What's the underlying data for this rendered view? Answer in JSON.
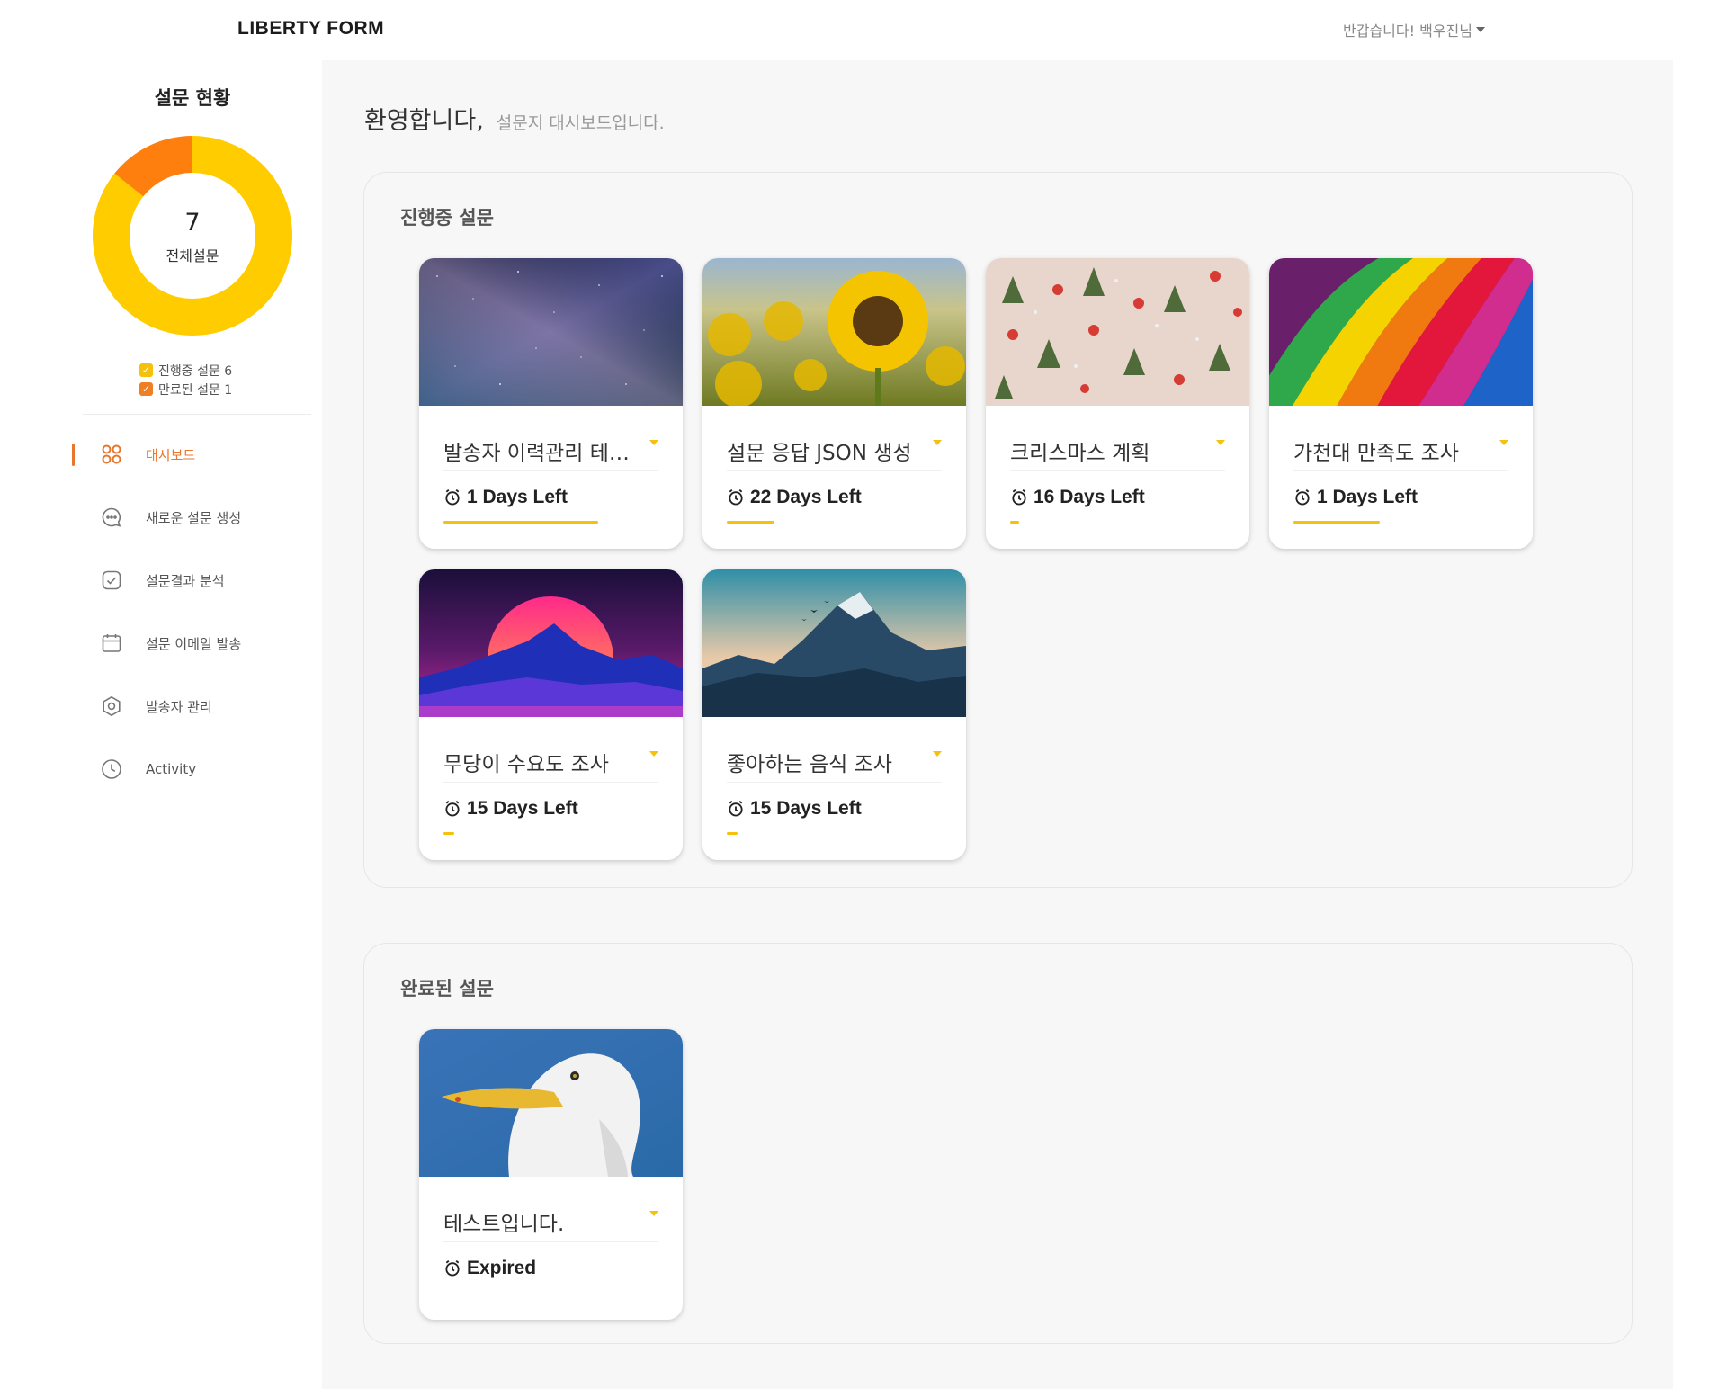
{
  "header": {
    "brand": "LIBERTY FORM",
    "user_greeting": "반갑습니다! 백우진님"
  },
  "sidebar": {
    "status_title": "설문 현황",
    "chart_data": {
      "type": "pie",
      "categories": [
        "진행중 설문",
        "만료된 설문"
      ],
      "values": [
        6,
        1
      ],
      "colors": [
        "#ffcc00",
        "#ff7f0e"
      ],
      "center_value": "7",
      "center_label": "전체설문"
    },
    "legend": [
      {
        "label": "진행중 설문 6",
        "color": "#f4c20d"
      },
      {
        "label": "만료된 설문 1",
        "color": "#ee7f24"
      }
    ],
    "nav": [
      {
        "label": "대시보드",
        "icon": "dashboard-icon",
        "active": true
      },
      {
        "label": "새로운 설문 생성",
        "icon": "chat-icon",
        "active": false
      },
      {
        "label": "설문결과 분석",
        "icon": "check-icon",
        "active": false
      },
      {
        "label": "설문 이메일 발송",
        "icon": "calendar-icon",
        "active": false
      },
      {
        "label": "발송자 관리",
        "icon": "gear-icon",
        "active": false
      },
      {
        "label": "Activity",
        "icon": "clock-icon",
        "active": false
      }
    ]
  },
  "main": {
    "welcome_title": "환영합니다,",
    "welcome_sub": "설문지 대시보드입니다.",
    "active_panel": {
      "title": "진행중 설문",
      "cards": [
        {
          "title": "발송자 이력관리 테스트",
          "meta": "1 Days Left",
          "image": "galaxy-night-sky",
          "progress": 0.72
        },
        {
          "title": "설문 응답 JSON 생성",
          "meta": "22 Days Left",
          "image": "sunflower-field",
          "progress": 0.22
        },
        {
          "title": "크리스마스 계획",
          "meta": "16 Days Left",
          "image": "christmas-pattern",
          "progress": 0.04
        },
        {
          "title": "가천대 만족도 조사",
          "meta": "1 Days Left",
          "image": "rainbow-paint-swirl",
          "progress": 0.4
        },
        {
          "title": "무당이 수요도 조사",
          "meta": "15 Days Left",
          "image": "synthwave-mountains",
          "progress": 0.05
        },
        {
          "title": "좋아하는 음식 조사",
          "meta": "15 Days Left",
          "image": "mountain-landscape",
          "progress": 0.05
        }
      ]
    },
    "expired_panel": {
      "title": "완료된 설문",
      "cards": [
        {
          "title": "테스트입니다.",
          "meta": "Expired",
          "image": "seagull-photo",
          "progress": 0
        }
      ]
    }
  }
}
